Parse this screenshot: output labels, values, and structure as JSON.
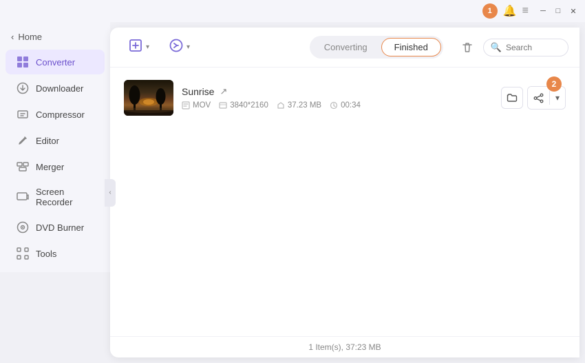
{
  "titlebar": {
    "icons": {
      "notification_badge": "1",
      "bell_label": "bell",
      "menu_label": "menu",
      "minimize_label": "minimize",
      "maximize_label": "maximize",
      "close_label": "close"
    }
  },
  "sidebar": {
    "back_label": "Home",
    "items": [
      {
        "id": "converter",
        "label": "Converter",
        "icon": "⊞",
        "active": true
      },
      {
        "id": "downloader",
        "label": "Downloader",
        "icon": "⬇"
      },
      {
        "id": "compressor",
        "label": "Compressor",
        "icon": "🗜"
      },
      {
        "id": "editor",
        "label": "Editor",
        "icon": "✂"
      },
      {
        "id": "merger",
        "label": "Merger",
        "icon": "⊞"
      },
      {
        "id": "screen-recorder",
        "label": "Screen Recorder",
        "icon": "⬛"
      },
      {
        "id": "dvd-burner",
        "label": "DVD Burner",
        "icon": "💿"
      },
      {
        "id": "tools",
        "label": "Tools",
        "icon": "⚙"
      }
    ]
  },
  "toolbar": {
    "add_btn_label": "",
    "add_dropdown_label": "",
    "convert_btn_label": "",
    "convert_dropdown_label": "",
    "tab_converting": "Converting",
    "tab_finished": "Finished",
    "delete_icon": "🗑",
    "search_placeholder": "Search"
  },
  "file_list": {
    "badge2": "2",
    "items": [
      {
        "name": "Sunrise",
        "format": "MOV",
        "resolution": "3840*2160",
        "size": "37.23 MB",
        "duration": "00:34"
      }
    ]
  },
  "status_bar": {
    "text": "1 Item(s), 37:23 MB"
  }
}
